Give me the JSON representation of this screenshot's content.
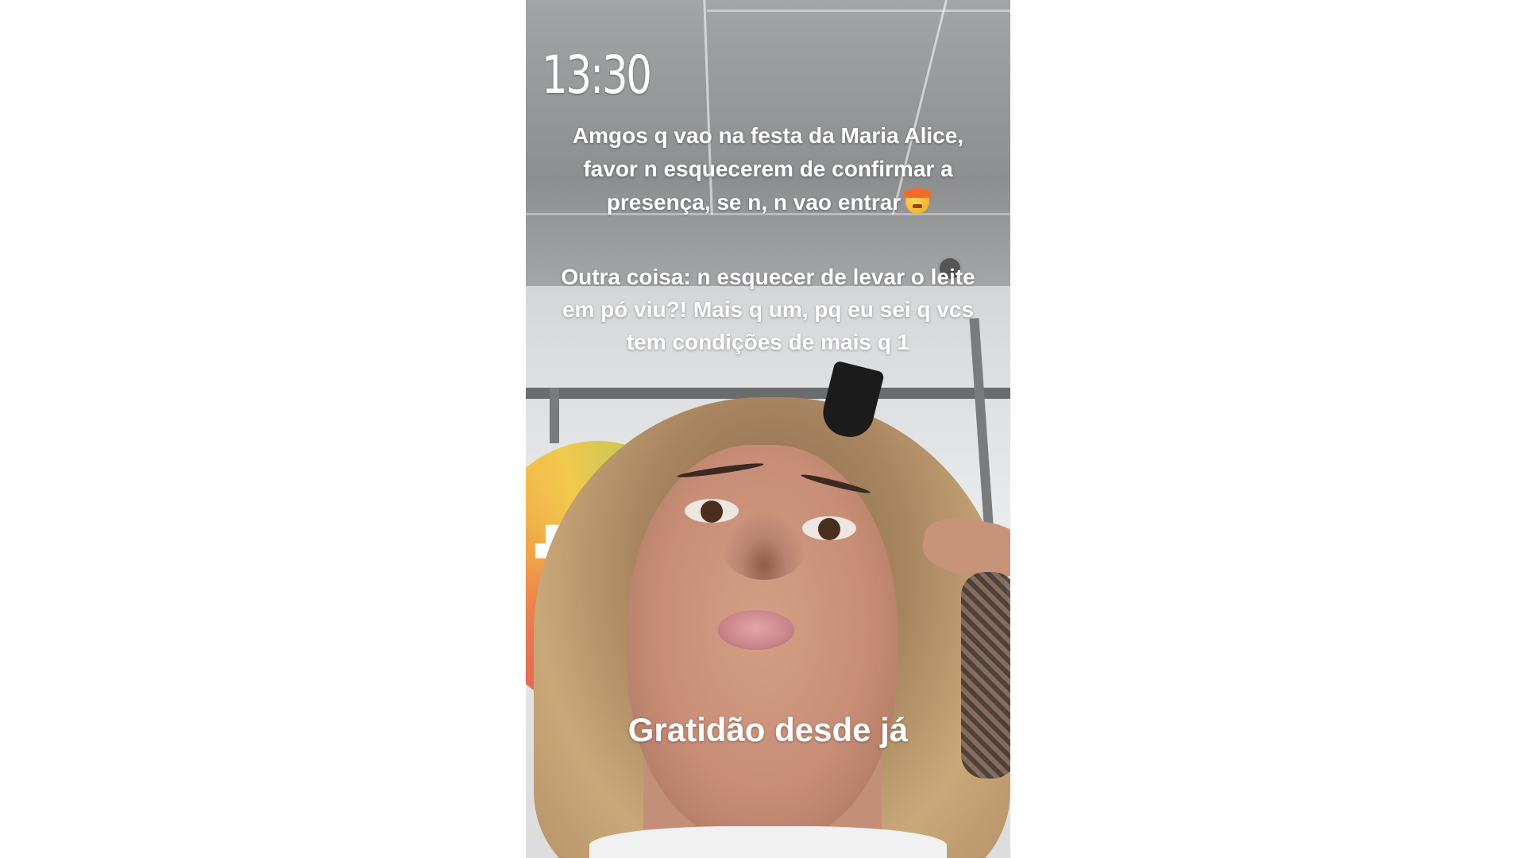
{
  "story": {
    "time": "13:30",
    "message_1": "Amgos q vao na festa da Maria Alice, favor n esquecerem de confirmar a presença, se n, n vao entrar",
    "message_1_emoji": "exploding-head-emoji",
    "message_2": "Outra coisa: n esquecer de levar o leite em pó viu?! Mais q um, pq eu sei q vcs tem condições de mais q 1",
    "caption": "Gratidão desde já"
  },
  "colors": {
    "page_background": "#ffffff",
    "text": "#ffffff"
  }
}
